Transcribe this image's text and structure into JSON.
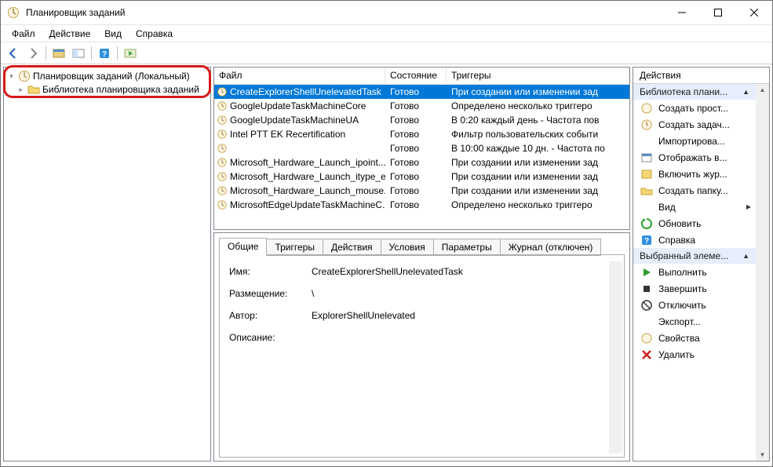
{
  "title": "Планировщик заданий",
  "menu": [
    "Файл",
    "Действие",
    "Вид",
    "Справка"
  ],
  "tree": {
    "root": "Планировщик заданий (Локальный)",
    "child": "Библиотека планировщика заданий"
  },
  "columns": {
    "file": "Файл",
    "state": "Состояние",
    "trig": "Триггеры"
  },
  "tasks": [
    {
      "file": "CreateExplorerShellUnelevatedTask",
      "state": "Готово",
      "trig": "При создании или изменении зад"
    },
    {
      "file": "GoogleUpdateTaskMachineCore",
      "state": "Готово",
      "trig": "Определено несколько триггеро"
    },
    {
      "file": "GoogleUpdateTaskMachineUA",
      "state": "Готово",
      "trig": "В 0:20 каждый день - Частота пов"
    },
    {
      "file": "Intel PTT EK Recertification",
      "state": "Готово",
      "trig": "Фильтр пользовательских событи"
    },
    {
      "file": "",
      "state": "Готово",
      "trig": "В 10:00 каждые 10 дн. - Частота по"
    },
    {
      "file": "Microsoft_Hardware_Launch_ipoint...",
      "state": "Готово",
      "trig": "При создании или изменении зад"
    },
    {
      "file": "Microsoft_Hardware_Launch_itype_exe",
      "state": "Готово",
      "trig": "При создании или изменении зад"
    },
    {
      "file": "Microsoft_Hardware_Launch_mouse...",
      "state": "Готово",
      "trig": "При создании или изменении зад"
    },
    {
      "file": "MicrosoftEdgeUpdateTaskMachineC...",
      "state": "Готово",
      "trig": "Определено несколько триггеро"
    }
  ],
  "tabs": [
    "Общие",
    "Триггеры",
    "Действия",
    "Условия",
    "Параметры",
    "Журнал (отключен)"
  ],
  "detail": {
    "name_k": "Имя:",
    "name_v": "CreateExplorerShellUnelevatedTask",
    "loc_k": "Размещение:",
    "loc_v": "\\",
    "author_k": "Автор:",
    "author_v": "ExplorerShellUnelevated",
    "desc_k": "Описание:"
  },
  "actions": {
    "title": "Действия",
    "group1": "Библиотека плани...",
    "items1": [
      "Создать прост...",
      "Создать задач...",
      "Импортирова...",
      "Отображать в...",
      "Включить жур...",
      "Создать папку...",
      "Вид",
      "Обновить",
      "Справка"
    ],
    "group2": "Выбранный элеме...",
    "items2": [
      "Выполнить",
      "Завершить",
      "Отключить",
      "Экспорт...",
      "Свойства",
      "Удалить"
    ]
  }
}
